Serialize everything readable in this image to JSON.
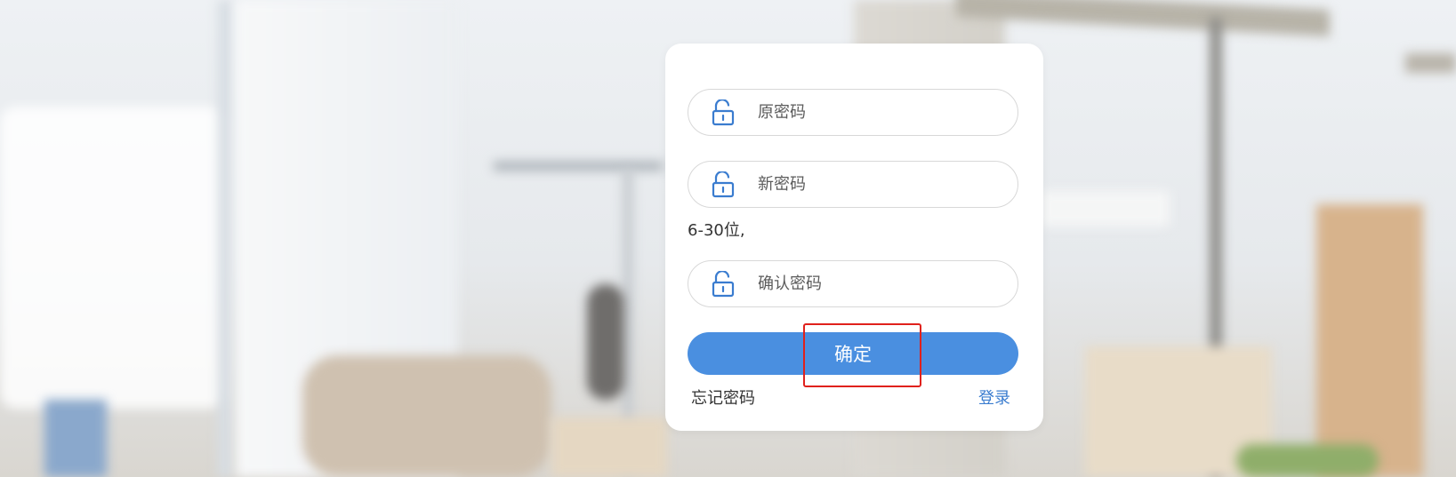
{
  "form": {
    "old_password": {
      "placeholder": "原密码",
      "value": "",
      "icon": "unlock-icon"
    },
    "new_password": {
      "placeholder": "新密码",
      "value": "",
      "icon": "unlock-icon"
    },
    "hint": "6-30位,",
    "confirm_password": {
      "placeholder": "确认密码",
      "value": "",
      "icon": "unlock-icon"
    },
    "confirm_label": "确定",
    "forgot_label": "忘记密码",
    "login_label": "登录"
  },
  "colors": {
    "accent": "#4a8fe0",
    "icon": "#3a7ccf",
    "link": "#3a7ccf",
    "highlight": "#e0211c"
  }
}
